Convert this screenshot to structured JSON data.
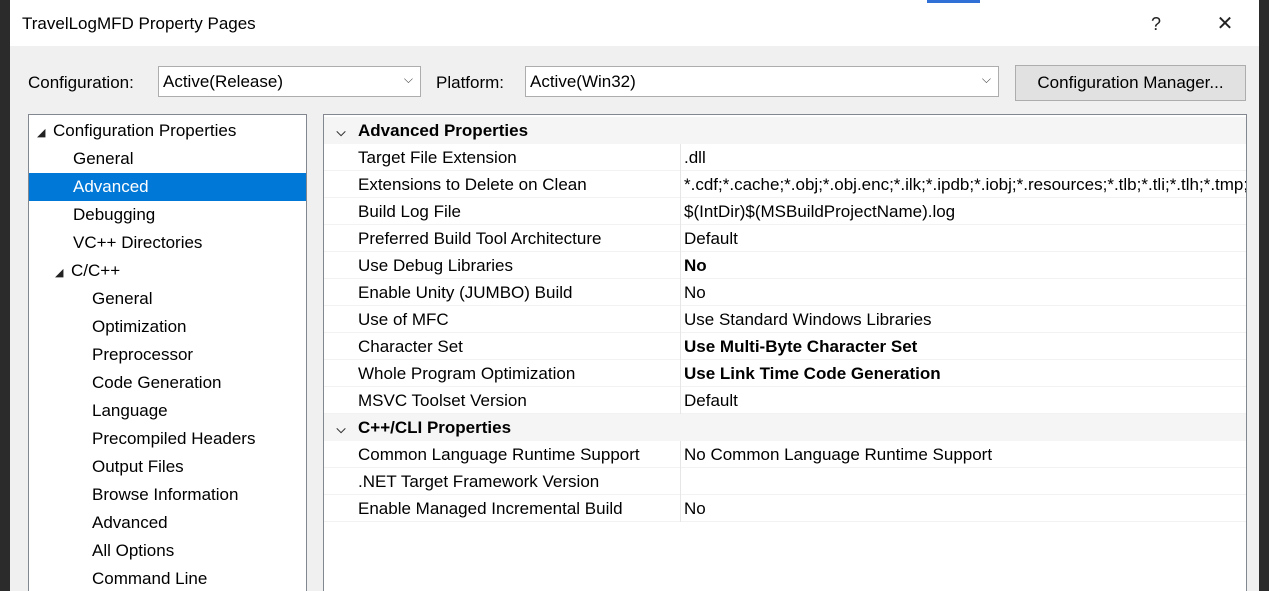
{
  "window": {
    "title": "TravelLogMFD Property Pages",
    "help_glyph": "?",
    "close_glyph": "✕"
  },
  "toolbar": {
    "configuration_label": "Configuration:",
    "configuration_value": "Active(Release)",
    "platform_label": "Platform:",
    "platform_value": "Active(Win32)",
    "config_manager_label": "Configuration Manager..."
  },
  "tree": [
    {
      "label": "Configuration Properties",
      "expanded": true
    },
    {
      "label": "General"
    },
    {
      "label": "Advanced",
      "selected": true
    },
    {
      "label": "Debugging"
    },
    {
      "label": "VC++ Directories"
    },
    {
      "label": "C/C++",
      "expanded": true
    },
    {
      "label": "General"
    },
    {
      "label": "Optimization"
    },
    {
      "label": "Preprocessor"
    },
    {
      "label": "Code Generation"
    },
    {
      "label": "Language"
    },
    {
      "label": "Precompiled Headers"
    },
    {
      "label": "Output Files"
    },
    {
      "label": "Browse Information"
    },
    {
      "label": "Advanced"
    },
    {
      "label": "All Options"
    },
    {
      "label": "Command Line"
    }
  ],
  "grid": {
    "categories": [
      {
        "title": "Advanced Properties",
        "properties": [
          {
            "name": "Target File Extension",
            "value": ".dll"
          },
          {
            "name": "Extensions to Delete on Clean",
            "value": "*.cdf;*.cache;*.obj;*.obj.enc;*.ilk;*.ipdb;*.iobj;*.resources;*.tlb;*.tli;*.tlh;*.tmp;*.rsp;*.pgc;*.pgd;*.meta;*.tlog;*.manifest;*.res;*.pch;*.exp;*.idb;*.rep;*.xdc;*.pdb;*_manifest.rc;*.bsc;*.sbr;*.xml;*.metagen;*.bi"
          },
          {
            "name": "Build Log File",
            "value": "$(IntDir)$(MSBuildProjectName).log"
          },
          {
            "name": "Preferred Build Tool Architecture",
            "value": "Default"
          },
          {
            "name": "Use Debug Libraries",
            "value": "No",
            "bold": true
          },
          {
            "name": "Enable Unity (JUMBO) Build",
            "value": "No"
          },
          {
            "name": "Use of MFC",
            "value": "Use Standard Windows Libraries"
          },
          {
            "name": "Character Set",
            "value": "Use Multi-Byte Character Set",
            "bold": true
          },
          {
            "name": "Whole Program Optimization",
            "value": "Use Link Time Code Generation",
            "bold": true
          },
          {
            "name": "MSVC Toolset Version",
            "value": "Default"
          }
        ]
      },
      {
        "title": "C++/CLI Properties",
        "properties": [
          {
            "name": "Common Language Runtime Support",
            "value": "No Common Language Runtime Support"
          },
          {
            "name": ".NET Target Framework Version",
            "value": ""
          },
          {
            "name": "Enable Managed Incremental Build",
            "value": "No"
          }
        ]
      }
    ]
  }
}
